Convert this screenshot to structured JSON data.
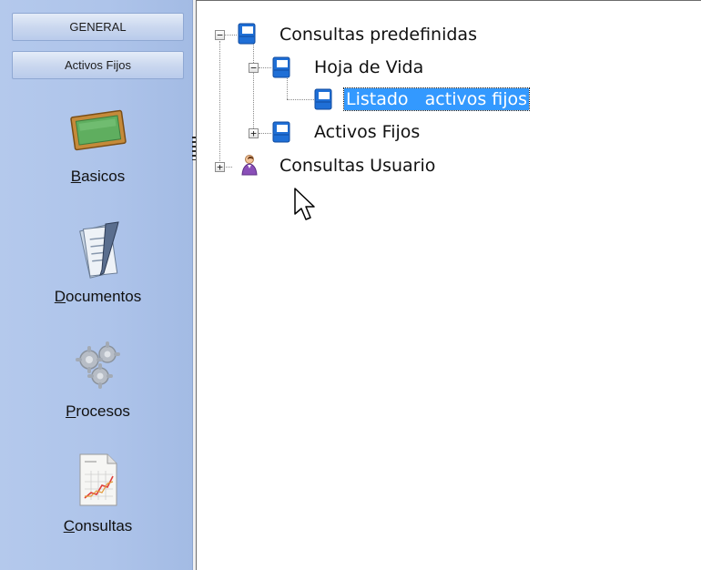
{
  "sidebar": {
    "groups": [
      {
        "label": "GENERAL"
      },
      {
        "label": "Activos Fijos"
      }
    ],
    "items": [
      {
        "mnemonic": "B",
        "rest": "asicos",
        "icon": "chalkboard-icon"
      },
      {
        "mnemonic": "D",
        "rest": "ocumentos",
        "icon": "documents-icon"
      },
      {
        "mnemonic": "P",
        "rest": "rocesos",
        "icon": "gears-icon"
      },
      {
        "mnemonic": "C",
        "rest": "onsultas",
        "icon": "chart-report-icon"
      }
    ]
  },
  "tree": {
    "nodes": [
      {
        "label": "Consultas predefinidas",
        "expanded": true,
        "icon": "notebook-icon"
      },
      {
        "label": "Hoja de Vida",
        "expanded": true,
        "icon": "notebook-icon"
      },
      {
        "label": "Listado   activos fijos",
        "selected": true,
        "icon": "notebook-icon"
      },
      {
        "label": "Activos Fijos",
        "expanded": false,
        "icon": "notebook-icon"
      },
      {
        "label": "Consultas Usuario",
        "expanded": false,
        "icon": "user-icon"
      }
    ]
  },
  "colors": {
    "sidebar": "#aec4ea",
    "selection": "#3399ff",
    "notebook": "#1f6fd6"
  }
}
